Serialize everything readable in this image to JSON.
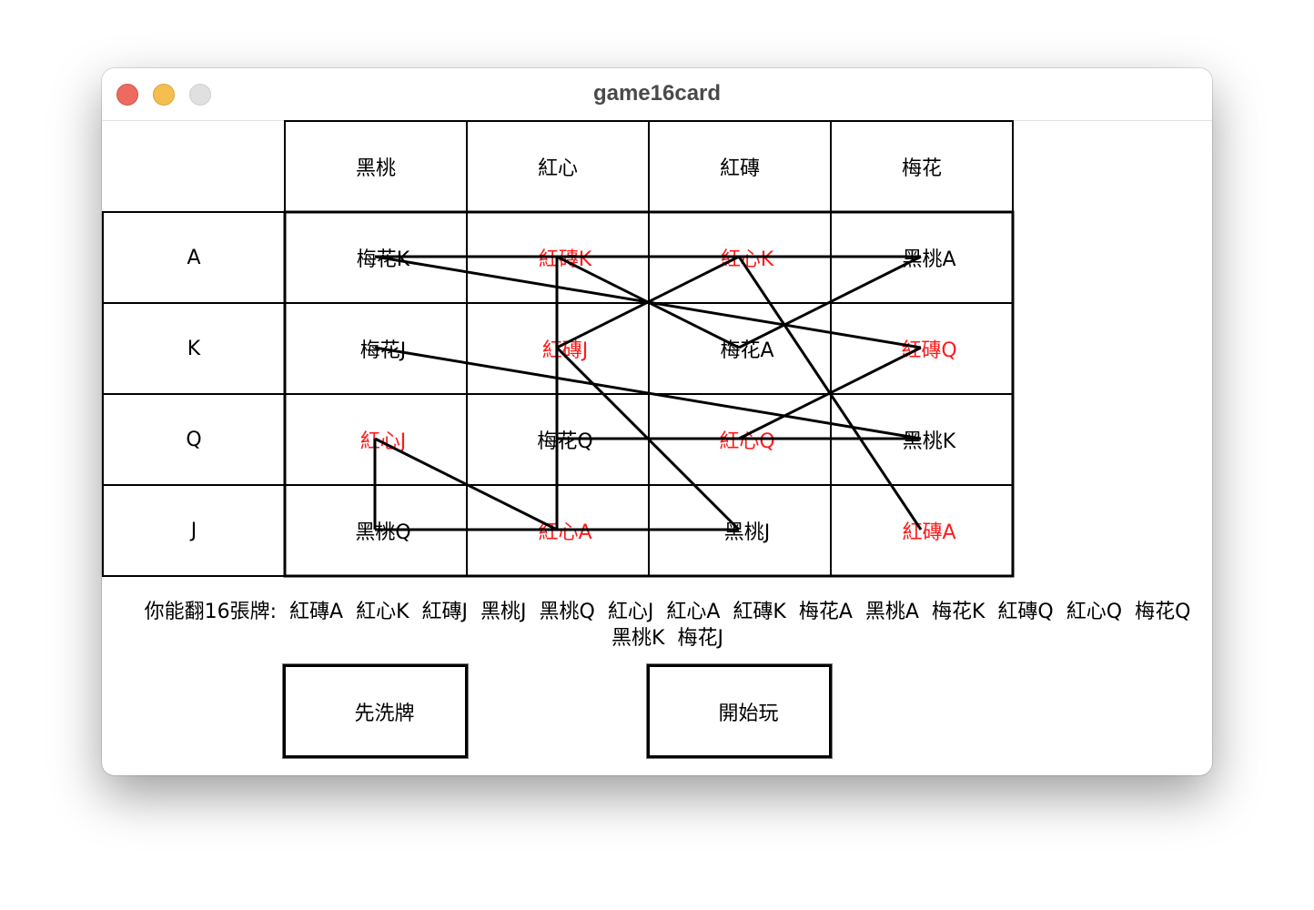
{
  "window": {
    "title": "game16card"
  },
  "board": {
    "suits": [
      "黑桃",
      "紅心",
      "紅磚",
      "梅花"
    ],
    "ranks": [
      "A",
      "K",
      "Q",
      "J"
    ],
    "cards": [
      [
        {
          "label": "梅花K",
          "color": "#000000"
        },
        {
          "label": "紅磚K",
          "color": "#ff1a1a"
        },
        {
          "label": "紅心K",
          "color": "#ff1a1a"
        },
        {
          "label": "黑桃A",
          "color": "#000000"
        }
      ],
      [
        {
          "label": "梅花J",
          "color": "#000000"
        },
        {
          "label": "紅磚J",
          "color": "#ff1a1a"
        },
        {
          "label": "梅花A",
          "color": "#000000"
        },
        {
          "label": "紅磚Q",
          "color": "#ff1a1a"
        }
      ],
      [
        {
          "label": "紅心J",
          "color": "#ff1a1a"
        },
        {
          "label": "梅花Q",
          "color": "#000000"
        },
        {
          "label": "紅心Q",
          "color": "#ff1a1a"
        },
        {
          "label": "黑桃K",
          "color": "#000000"
        }
      ],
      [
        {
          "label": "黑桃Q",
          "color": "#000000"
        },
        {
          "label": "紅心A",
          "color": "#ff1a1a"
        },
        {
          "label": "黑桃J",
          "color": "#000000"
        },
        {
          "label": "紅磚A",
          "color": "#ff1a1a"
        }
      ]
    ],
    "path": [
      "紅磚A",
      "紅心K",
      "紅磚J",
      "黑桃J",
      "黑桃Q",
      "紅心J",
      "紅心A",
      "紅磚K",
      "梅花A",
      "黑桃A",
      "梅花K",
      "紅磚Q",
      "紅心Q",
      "梅花Q",
      "黑桃K",
      "梅花J"
    ]
  },
  "info": {
    "label": "你能翻16張牌:",
    "sequence": [
      "紅磚A",
      "紅心K",
      "紅磚J",
      "黑桃J",
      "黑桃Q",
      "紅心J",
      "紅心A",
      "紅磚K",
      "梅花A",
      "黑桃A",
      "梅花K",
      "紅磚Q",
      "紅心Q",
      "梅花Q",
      "黑桃K",
      "梅花J"
    ]
  },
  "buttons": {
    "shuffle": "先洗牌",
    "start": "開始玩"
  }
}
